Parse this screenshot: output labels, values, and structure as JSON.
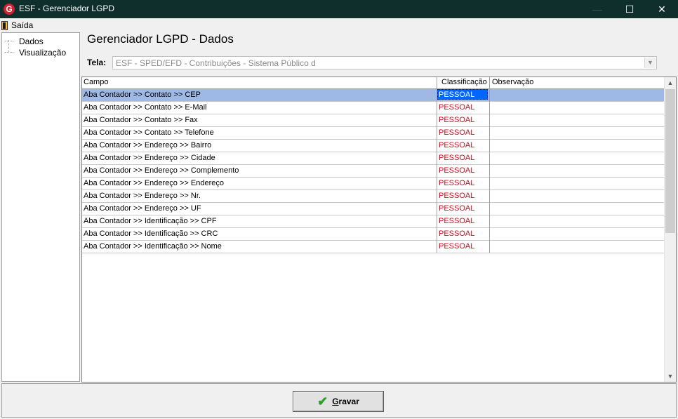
{
  "window": {
    "title": "ESF - Gerenciador LGPD",
    "icon": "esf-logo-icon",
    "minimize": "—",
    "maximize": "☐",
    "close": "✕"
  },
  "menu": {
    "items": [
      {
        "label": "Saída",
        "icon": "exit-door-icon"
      }
    ]
  },
  "tree": {
    "items": [
      {
        "label": "Dados"
      },
      {
        "label": "Visualização"
      }
    ]
  },
  "page": {
    "title": "Gerenciador LGPD - Dados"
  },
  "tela": {
    "label": "Tela:",
    "value": "ESF - SPED/EFD - Contribuições - Sistema Público d"
  },
  "grid": {
    "columns": [
      "Campo",
      "Classificação",
      "Observação"
    ],
    "selected_row": 0,
    "rows": [
      {
        "campo": "Aba Contador >> Contato >> CEP",
        "classificacao": "PESSOAL",
        "observacao": ""
      },
      {
        "campo": "Aba Contador >> Contato >> E-Mail",
        "classificacao": "PESSOAL",
        "observacao": ""
      },
      {
        "campo": "Aba Contador >> Contato >> Fax",
        "classificacao": "PESSOAL",
        "observacao": ""
      },
      {
        "campo": "Aba Contador >> Contato >> Telefone",
        "classificacao": "PESSOAL",
        "observacao": ""
      },
      {
        "campo": "Aba Contador >> Endereço >> Bairro",
        "classificacao": "PESSOAL",
        "observacao": ""
      },
      {
        "campo": "Aba Contador >> Endereço >> Cidade",
        "classificacao": "PESSOAL",
        "observacao": ""
      },
      {
        "campo": "Aba Contador >> Endereço >> Complemento",
        "classificacao": "PESSOAL",
        "observacao": ""
      },
      {
        "campo": "Aba Contador >> Endereço >> Endereço",
        "classificacao": "PESSOAL",
        "observacao": ""
      },
      {
        "campo": "Aba Contador >> Endereço >> Nr.",
        "classificacao": "PESSOAL",
        "observacao": ""
      },
      {
        "campo": "Aba Contador >> Endereço >> UF",
        "classificacao": "PESSOAL",
        "observacao": ""
      },
      {
        "campo": "Aba Contador >> Identificação >> CPF",
        "classificacao": "PESSOAL",
        "observacao": ""
      },
      {
        "campo": "Aba Contador >> Identificação >> CRC",
        "classificacao": "PESSOAL",
        "observacao": ""
      },
      {
        "campo": "Aba Contador >> Identificação >> Nome",
        "classificacao": "PESSOAL",
        "observacao": ""
      }
    ]
  },
  "footer": {
    "save_label_prefix": "",
    "save_label_accel": "G",
    "save_label_rest": "ravar",
    "save_icon": "checkmark-icon"
  },
  "colors": {
    "titlebar": "#0f2f2c",
    "selection": "#9fb9e6",
    "classification_text": "#e0001a",
    "cell_focus": "#0066ff",
    "check": "#2aa02a"
  }
}
